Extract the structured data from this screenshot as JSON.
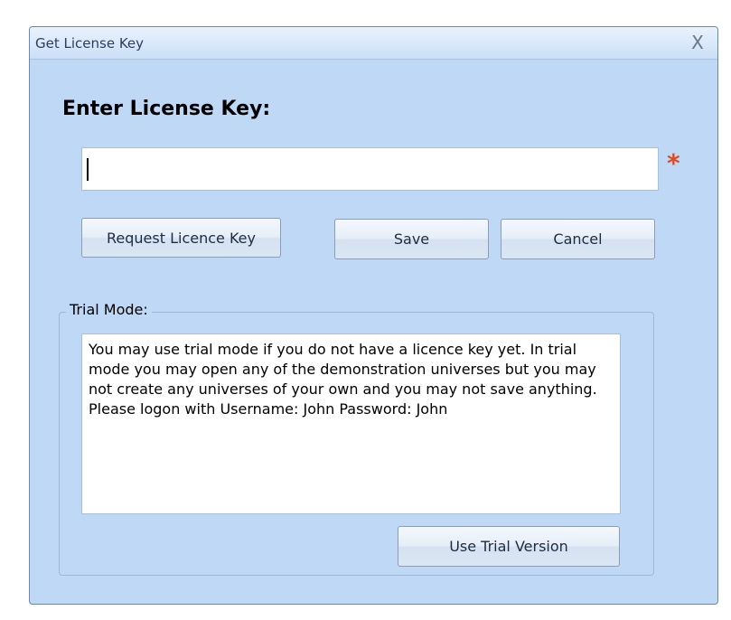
{
  "window": {
    "title": "Get License Key",
    "close_glyph": "X"
  },
  "form": {
    "heading": "Enter License Key:",
    "license_key_value": "",
    "required_marker": "*"
  },
  "buttons": {
    "request": "Request Licence Key",
    "save": "Save",
    "cancel": "Cancel",
    "use_trial": "Use Trial Version"
  },
  "trial": {
    "group_label": "Trial Mode:",
    "description": "You may use trial mode if you do not have a licence key yet. In trial mode you may open any of the demonstration universes but you may not create any universes of your own and you may not save anything. Please logon with Username: John Password: John"
  },
  "colors": {
    "dialog_background": "#bfd8f6",
    "required_marker": "#e04a20"
  },
  "icons": {
    "close": "close-icon"
  }
}
